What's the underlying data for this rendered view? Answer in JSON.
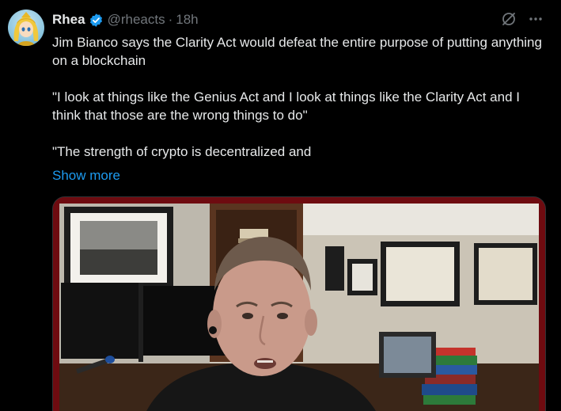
{
  "author": {
    "name": "Rhea",
    "handle": "@rheacts",
    "separator": "·",
    "time": "18h",
    "verified": true
  },
  "tweet": {
    "paragraphs": [
      "Jim Bianco says the Clarity Act would defeat the entire purpose of putting anything on a blockchain",
      "\"I look at things like the Genius Act and I look at things like the Clarity Act and I think that those are the wrong things to do\"",
      "\"The strength of crypto is decentralized and"
    ],
    "show_more_label": "Show more"
  },
  "icons": {
    "verified": "verified-badge-icon",
    "grok": "grok-icon",
    "more": "more-icon"
  },
  "colors": {
    "background": "#000000",
    "text": "#e7e9ea",
    "muted": "#71767b",
    "accent": "#1d9bf0"
  }
}
